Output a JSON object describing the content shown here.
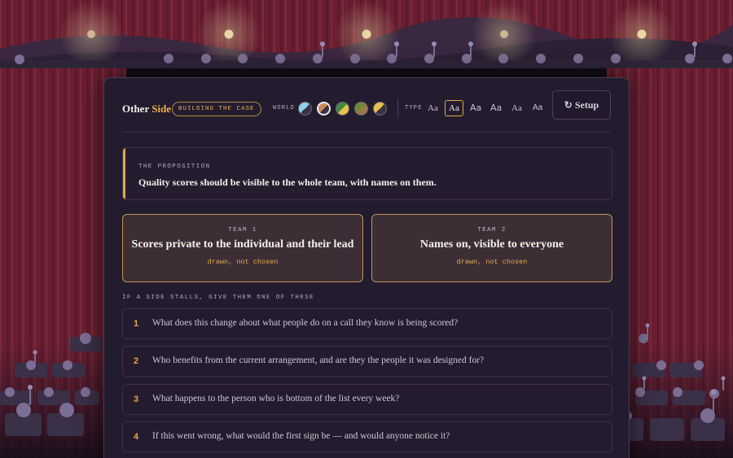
{
  "brand": {
    "title_prefix": "Other",
    "title_accent": "Side"
  },
  "stage_badge": "BUILDING THE CASE",
  "world": {
    "label": "WORLD",
    "options": [
      {
        "name": "sky",
        "c1": "#8fd0ea",
        "c2": "#3a3142",
        "selected": false
      },
      {
        "name": "copper",
        "c1": "#c98a5a",
        "c2": "#3a3142",
        "selected": true
      },
      {
        "name": "lime-gold",
        "c1": "#3f8a3a",
        "c2": "#e8c34a",
        "selected": false
      },
      {
        "name": "olive",
        "c1": "#6d8a3a",
        "c2": "#9a7a48",
        "selected": false
      },
      {
        "name": "gold",
        "c1": "#e6c24a",
        "c2": "#3a3142",
        "selected": false
      }
    ]
  },
  "type": {
    "label": "TYPE",
    "options": [
      {
        "label": "Aa",
        "selected": false
      },
      {
        "label": "Aa",
        "selected": true
      },
      {
        "label": "Aa",
        "selected": false
      },
      {
        "label": "Aa",
        "selected": false
      },
      {
        "label": "Aa",
        "selected": false
      },
      {
        "label": "Aa",
        "selected": false
      }
    ]
  },
  "setup_button": {
    "icon": "refresh-icon",
    "glyph": "↻",
    "label": "Setup"
  },
  "proposition": {
    "label": "THE PROPOSITION",
    "text": "Quality scores should be visible to the whole team, with names on them."
  },
  "teams": [
    {
      "label": "TEAM 1",
      "name": "Scores private to the individual and their lead",
      "status": "drawn, not chosen"
    },
    {
      "label": "TEAM 2",
      "name": "Names on, visible to everyone",
      "status": "drawn, not chosen"
    }
  ],
  "prompts": {
    "label": "IF A SIDE STALLS, GIVE THEM ONE OF THESE",
    "items": [
      {
        "num": "1",
        "text": "What does this change about what people do on a call they know is being scored?"
      },
      {
        "num": "2",
        "text": "Who benefits from the current arrangement, and are they the people it was designed for?"
      },
      {
        "num": "3",
        "text": "What happens to the person who is bottom of the list every week?"
      },
      {
        "num": "4",
        "text": "If this went wrong, what would the first sign be — and would anyone notice it?"
      }
    ]
  },
  "colors": {
    "accent": "#e8b04c",
    "panel": "#231b2e",
    "curtain": "#6b1f33"
  }
}
